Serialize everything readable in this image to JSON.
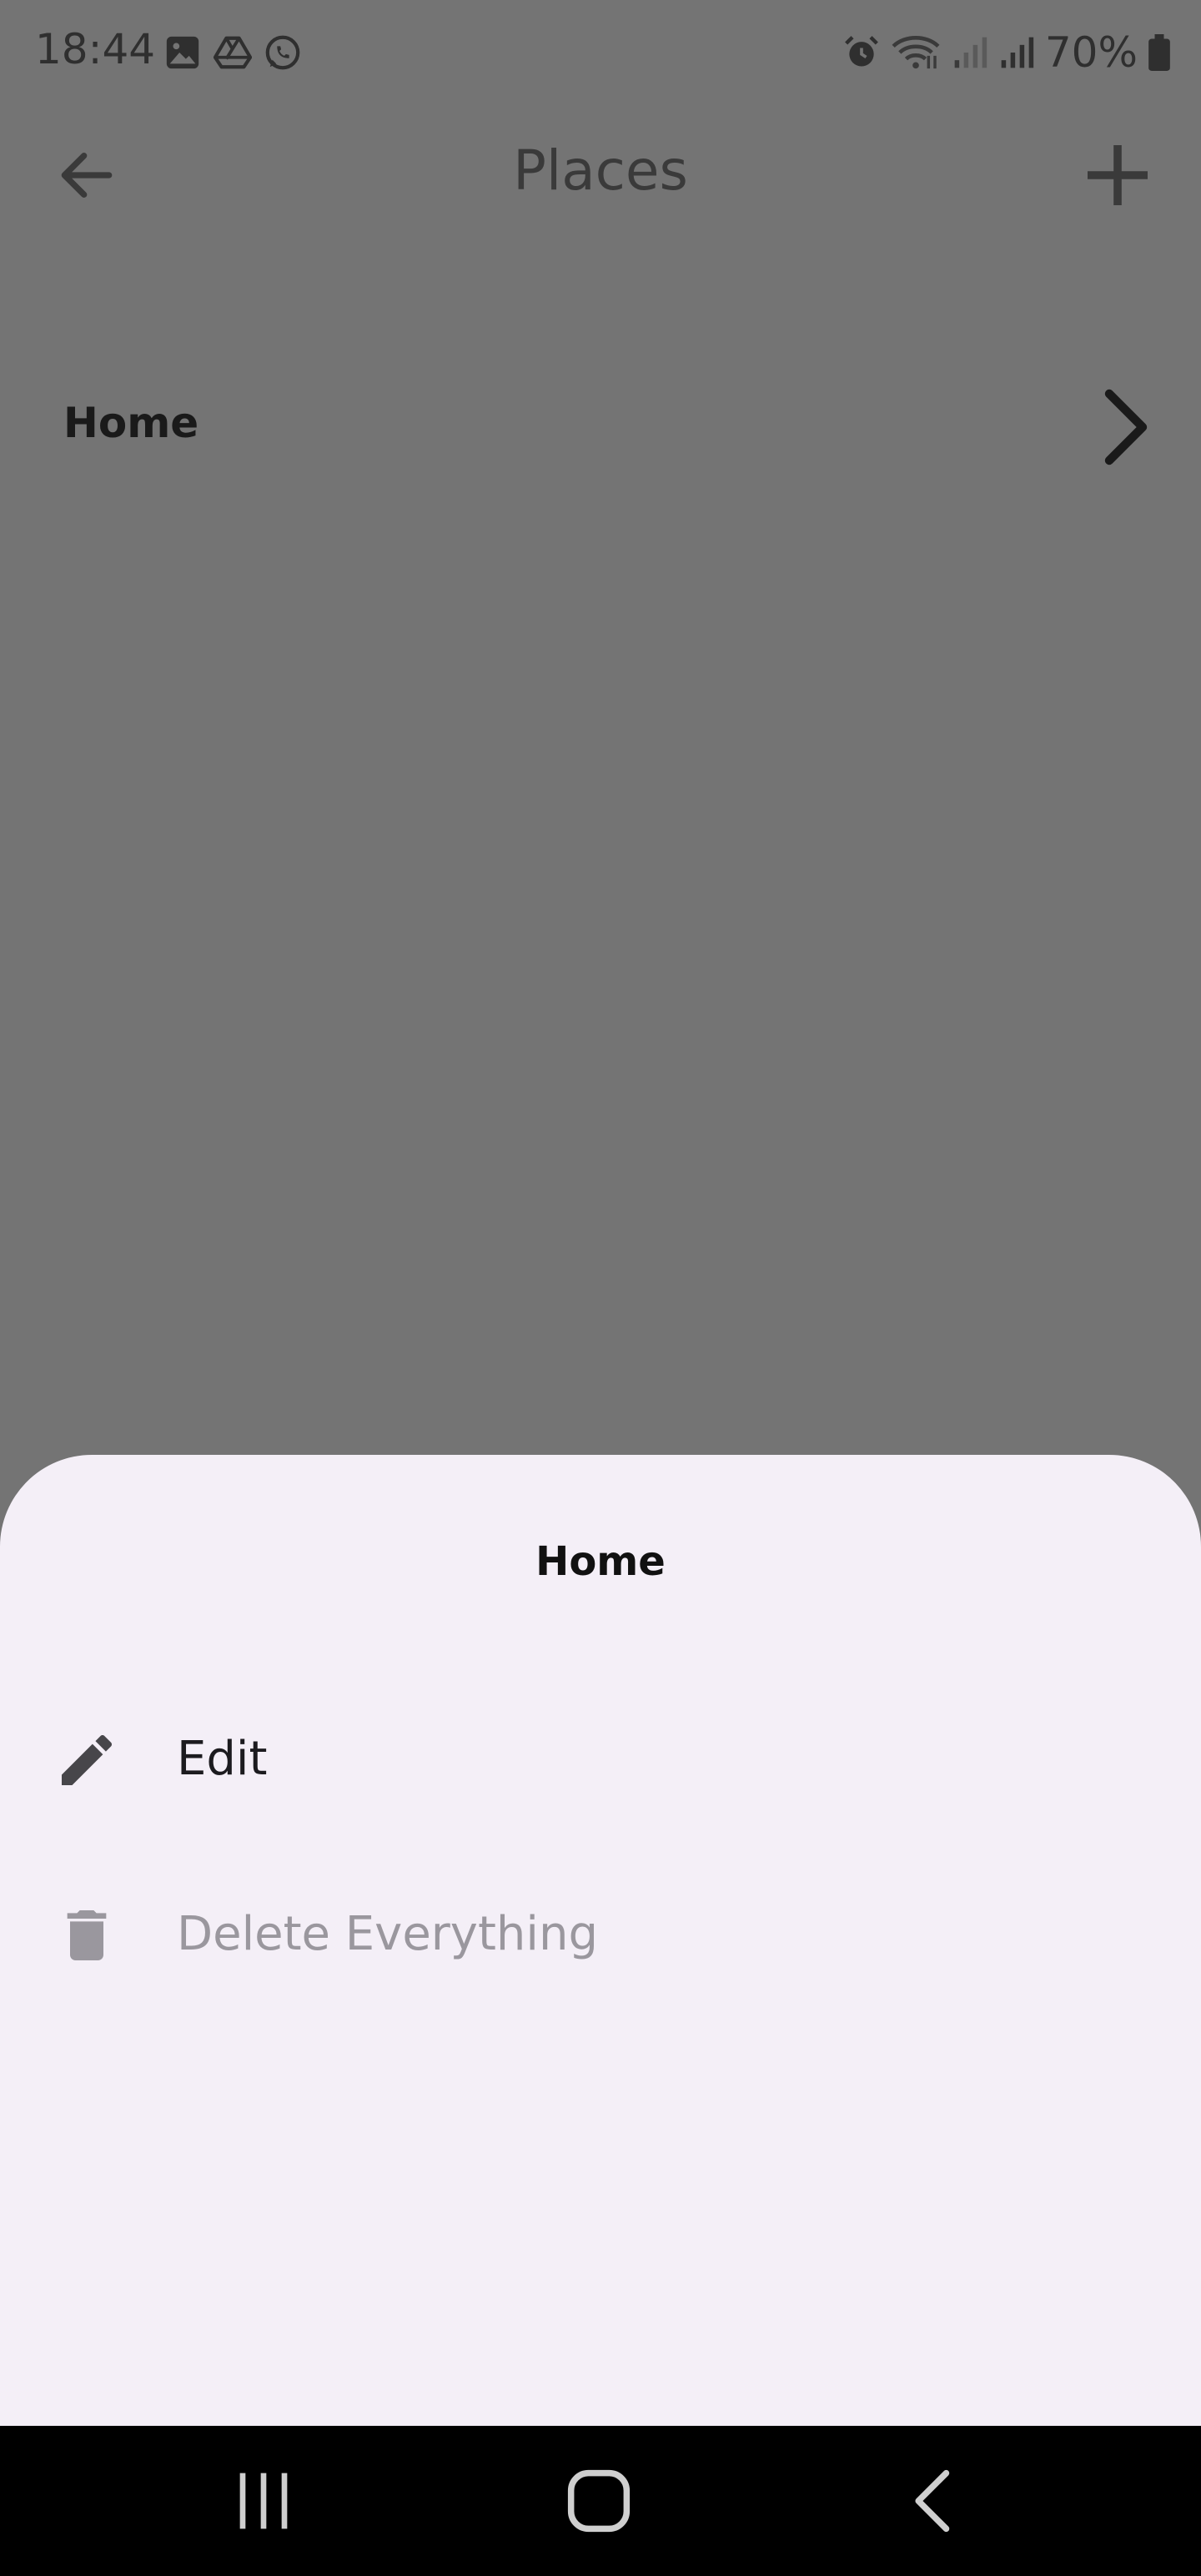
{
  "status_bar": {
    "time": "18:44",
    "left_icons": [
      "gallery-icon",
      "drive-icon",
      "whatsapp-icon"
    ],
    "right_icons": [
      "alarm-icon",
      "wifi-icon",
      "signal-weak-icon",
      "signal-icon",
      "battery-icon"
    ],
    "battery_text": "70%"
  },
  "appbar": {
    "title": "Places",
    "back_icon": "arrow-back-icon",
    "add_icon": "plus-icon"
  },
  "places": {
    "items": [
      {
        "label": "Home"
      }
    ]
  },
  "sheet": {
    "title": "Home",
    "edit_label": "Edit",
    "delete_label": "Delete Everything"
  },
  "nav_bar": {
    "buttons": [
      "recents-icon",
      "home-icon",
      "back-icon"
    ]
  },
  "colors": {
    "scrim": "#747474",
    "sheet_background": "#f4eff7",
    "disabled_text": "#9a979e",
    "nav_background": "#000000"
  }
}
